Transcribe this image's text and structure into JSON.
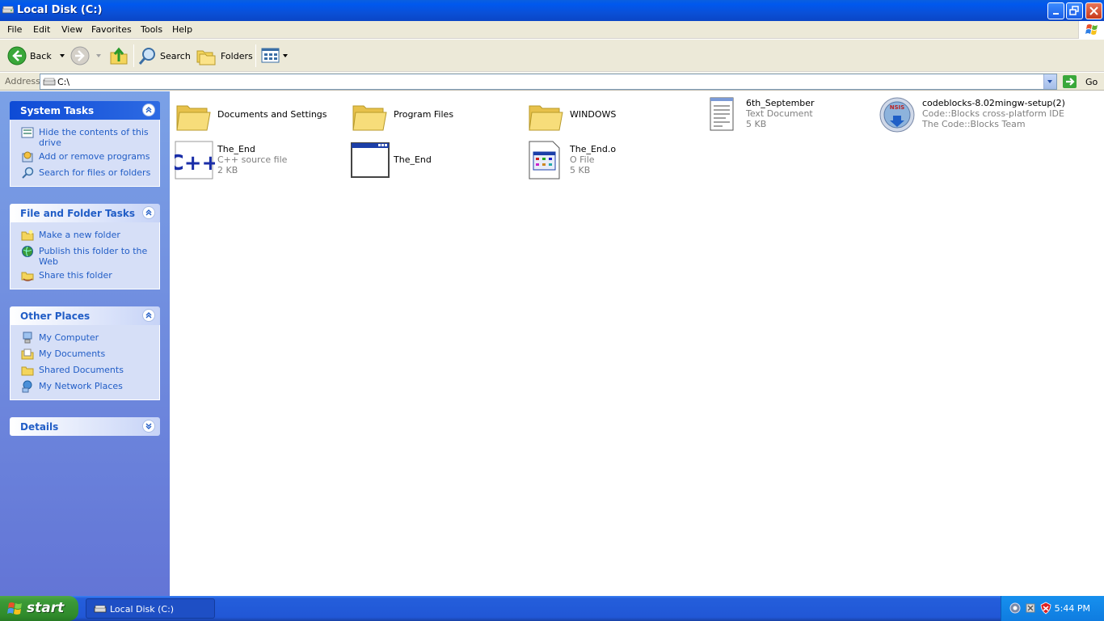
{
  "window": {
    "title": "Local Disk (C:)"
  },
  "menu": [
    "File",
    "Edit",
    "View",
    "Favorites",
    "Tools",
    "Help"
  ],
  "toolbar": {
    "back_label": "Back",
    "search_label": "Search",
    "folders_label": "Folders"
  },
  "address": {
    "label": "Address",
    "value": "C:\\",
    "go_label": "Go"
  },
  "panels": {
    "system_tasks": {
      "title": "System Tasks",
      "items": [
        {
          "label": "Hide the contents of this drive",
          "icon": "hide-contents-icon"
        },
        {
          "label": "Add or remove programs",
          "icon": "add-remove-programs-icon"
        },
        {
          "label": "Search for files or folders",
          "icon": "search-icon"
        }
      ]
    },
    "file_folder_tasks": {
      "title": "File and Folder Tasks",
      "items": [
        {
          "label": "Make a new folder",
          "icon": "new-folder-icon"
        },
        {
          "label": "Publish this folder to the Web",
          "icon": "publish-web-icon"
        },
        {
          "label": "Share this folder",
          "icon": "share-folder-icon"
        }
      ]
    },
    "other_places": {
      "title": "Other Places",
      "items": [
        {
          "label": "My Computer",
          "icon": "computer-icon"
        },
        {
          "label": "My Documents",
          "icon": "documents-icon"
        },
        {
          "label": "Shared Documents",
          "icon": "shared-folder-icon"
        },
        {
          "label": "My Network Places",
          "icon": "network-icon"
        }
      ]
    },
    "details": {
      "title": "Details"
    }
  },
  "files": [
    {
      "name": "Documents and Settings",
      "type": "",
      "size": "",
      "icon": "folder-icon"
    },
    {
      "name": "Program Files",
      "type": "",
      "size": "",
      "icon": "folder-icon"
    },
    {
      "name": "WINDOWS",
      "type": "",
      "size": "",
      "icon": "folder-icon"
    },
    {
      "name": "6th_September",
      "type": "Text Document",
      "size": "5 KB",
      "icon": "text-document-icon"
    },
    {
      "name": "codeblocks-8.02mingw-setup(2)",
      "type": "Code::Blocks cross-platform IDE",
      "size": "The Code::Blocks Team",
      "icon": "installer-icon"
    },
    {
      "name": "The_End",
      "type": "C++ source file",
      "size": "2 KB",
      "icon": "cpp-file-icon"
    },
    {
      "name": "The_End",
      "type": "",
      "size": "",
      "icon": "application-icon"
    },
    {
      "name": "The_End.o",
      "type": "O File",
      "size": "5 KB",
      "icon": "object-file-icon"
    }
  ],
  "taskbar": {
    "start_label": "start",
    "task_label": "Local Disk (C:)",
    "clock": "5:44 PM"
  },
  "colors": {
    "title_bar": "#0a5fe0",
    "task_link": "#215dc6",
    "panel_bg": "#d6dff7",
    "start_green": "#3c9a37"
  }
}
